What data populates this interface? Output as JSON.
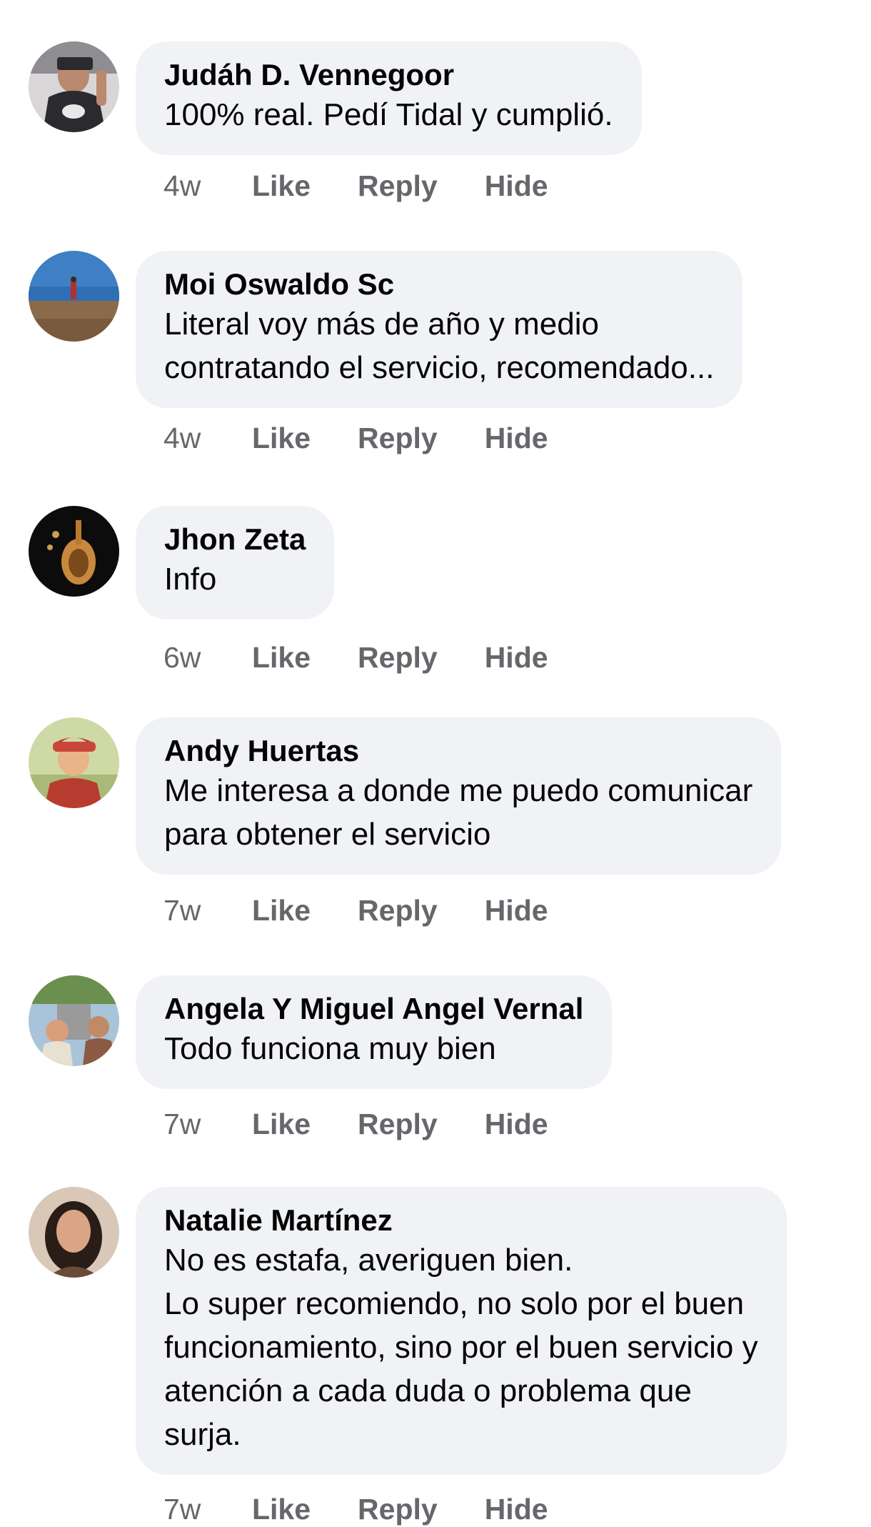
{
  "comments": [
    {
      "author": "Judáh D. Vennegoor",
      "text": "100% real. Pedí Tidal y cumplió.",
      "time": "4w",
      "like": "Like",
      "reply": "Reply",
      "hide": "Hide",
      "avatar_colors": [
        "#2b2a2e",
        "#b98970"
      ]
    },
    {
      "author": "Moi Oswaldo Sc",
      "text": "Literal voy más de año y medio\ncontratando el servicio, recomendado...",
      "time": "4w",
      "like": "Like",
      "reply": "Reply",
      "hide": "Hide",
      "avatar_colors": [
        "#2f6fb4",
        "#7a5a3c"
      ]
    },
    {
      "author": "Jhon Zeta",
      "text": "Info",
      "time": "6w",
      "like": "Like",
      "reply": "Reply",
      "hide": "Hide",
      "avatar_colors": [
        "#0c0c0c",
        "#c8893c"
      ]
    },
    {
      "author": "Andy Huertas",
      "text": "Me interesa a donde me puedo comunicar\npara obtener el servicio",
      "time": "7w",
      "like": "Like",
      "reply": "Reply",
      "hide": "Hide",
      "avatar_colors": [
        "#cfd9a6",
        "#b73b2e"
      ]
    },
    {
      "author": "Angela Y Miguel Angel Vernal",
      "text": "Todo funciona muy bien",
      "time": "7w",
      "like": "Like",
      "reply": "Reply",
      "hide": "Hide",
      "avatar_colors": [
        "#6b8f4e",
        "#8a5a44"
      ]
    },
    {
      "author": "Natalie Martínez",
      "text": "No es estafa, averiguen bien.\nLo super recomiendo, no solo por el buen\nfuncionamiento, sino por el buen servicio y\natención a cada duda o problema que\nsurja.",
      "time": "7w",
      "like": "Like",
      "reply": "Reply",
      "hide": "Hide",
      "avatar_colors": [
        "#d9c8b8",
        "#2a1d18"
      ]
    }
  ]
}
